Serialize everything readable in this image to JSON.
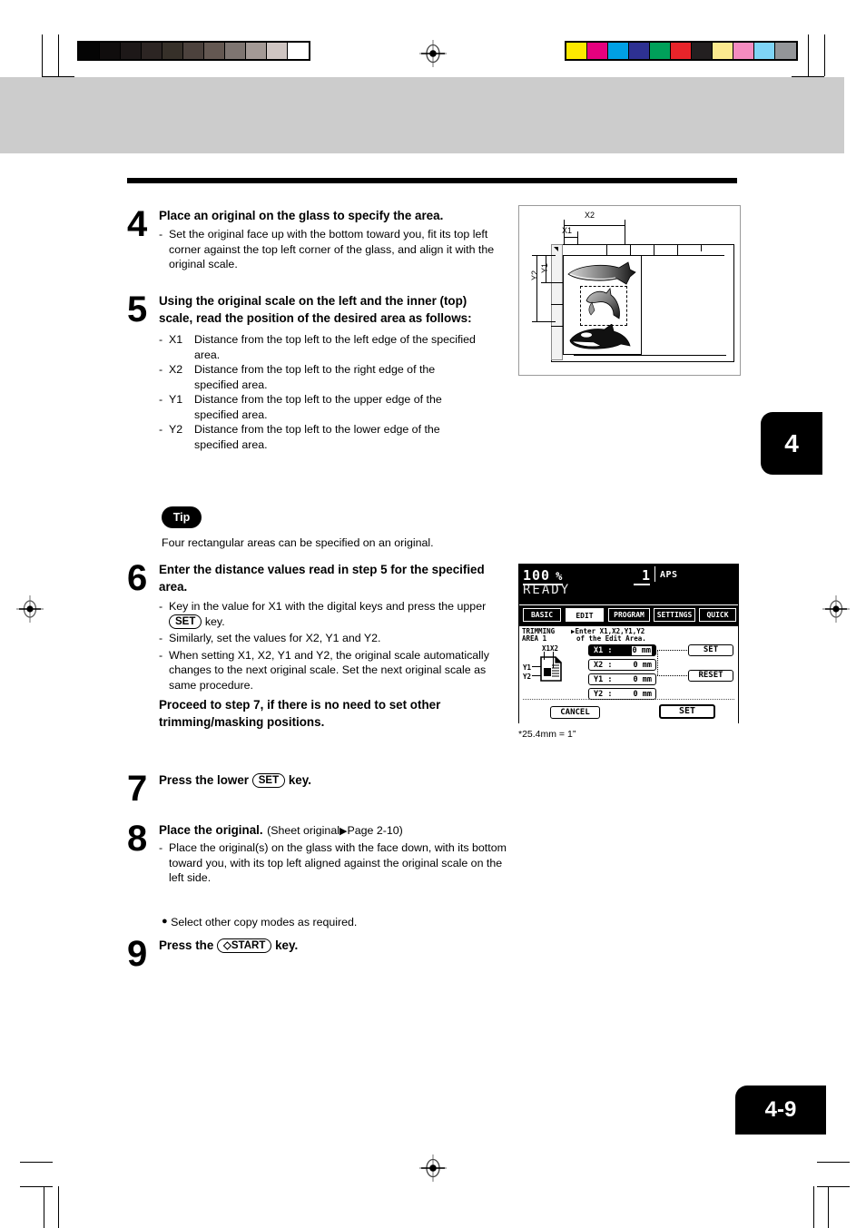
{
  "page": {
    "chapter_tab": "4",
    "page_number": "4-9",
    "footnote": "*25.4mm = 1”"
  },
  "color_bars": {
    "grayscale": [
      "#040404",
      "#100d0d",
      "#1d1818",
      "#2c2523",
      "#363029",
      "#4c423d",
      "#645852",
      "#7e7571",
      "#a49a96",
      "#cfc5c2",
      "#ffffff"
    ],
    "colors": [
      "#fce900",
      "#e6007e",
      "#00a0e4",
      "#2e3192",
      "#00a05a",
      "#e8242a",
      "#231f20",
      "#fbe98f",
      "#f48cc0",
      "#7fd4f6",
      "#939598"
    ]
  },
  "steps": [
    {
      "num": "4",
      "head": "Place an original on the glass to specify the area.",
      "bullets": [
        "Set the original face up with the bottom toward you, fit its top left corner against the top left corner of the glass, and align it with the original scale."
      ]
    },
    {
      "num": "5",
      "head": "Using the original scale on the left and the inner (top) scale, read the position of the desired area as follows:",
      "definitions": [
        {
          "label": "X1",
          "text": "Distance from the top left to the left edge of the specified area."
        },
        {
          "label": "X2",
          "text": "Distance from the top left to the right edge of the specified area."
        },
        {
          "label": "Y1",
          "text": "Distance from the top left to the upper edge of the specified area."
        },
        {
          "label": "Y2",
          "text": "Distance from the top left to the lower edge of the specified area."
        }
      ]
    },
    {
      "num": "6",
      "head": "Enter the distance values read in step 5 for the specified area.",
      "bullet_1a": "Key in the value for X1 with the digital keys and press the upper",
      "bullet_1_key": "SET",
      "bullet_1b": "key.",
      "bullet_2": "Similarly, set the values for X2, Y1 and Y2.",
      "bullet_3": "When setting X1, X2, Y1 and Y2, the original scale automatically changes to the next original scale. Set the next original scale as same procedure.",
      "note": "Proceed to step 7, if there is no need to set other trimming/masking positions."
    },
    {
      "num": "7",
      "head_a": "Press the lower",
      "head_key": "SET",
      "head_b": "key."
    },
    {
      "num": "8",
      "head": "Place the original.",
      "head_ref": "(Sheet original",
      "head_ref2": "Page 2-10)",
      "bullets": [
        "Place the original(s) on the glass with the face down, with its bottom toward you, with its top left aligned against the original scale on the left side."
      ]
    },
    {
      "num": "9",
      "head_a": "Press the",
      "head_key": "◇START",
      "head_b": "key."
    }
  ],
  "tip": {
    "badge": "Tip",
    "text": "Four rectangular areas can be specified on an original."
  },
  "extra_bullet": "Select other copy modes as required.",
  "diagram": {
    "labels": {
      "x1": "X1",
      "x2": "X2",
      "y1": "Y1",
      "y2": "Y2"
    },
    "caption": ""
  },
  "lcd": {
    "ratio": "100",
    "percent": "%",
    "copy_count": "1",
    "paper_mode": "APS",
    "status": "READY",
    "tabs": [
      {
        "label": "BASIC",
        "active": false
      },
      {
        "label": "EDIT",
        "active": true
      },
      {
        "label": "PROGRAM",
        "active": false
      },
      {
        "label": "SETTINGS",
        "active": false
      },
      {
        "label": "QUICK",
        "active": false
      }
    ],
    "mode_label_line1": "TRIMMING",
    "mode_label_line2": "AREA 1",
    "message_line1": "Enter X1,X2,Y1,Y2",
    "message_line2": "of the Edit Area.",
    "icon_labels": {
      "x": "X1X2",
      "y1": "Y1",
      "y2": "Y2"
    },
    "fields": [
      {
        "name": "X1 :",
        "value": "0 mm",
        "selected": true
      },
      {
        "name": "X2 :",
        "value": "0 mm",
        "selected": false
      },
      {
        "name": "Y1 :",
        "value": "0 mm",
        "selected": false
      },
      {
        "name": "Y2 :",
        "value": "0 mm",
        "selected": false
      }
    ],
    "buttons": {
      "set_upper": "SET",
      "reset": "RESET",
      "cancel": "CANCEL",
      "set_lower": "SET"
    }
  }
}
